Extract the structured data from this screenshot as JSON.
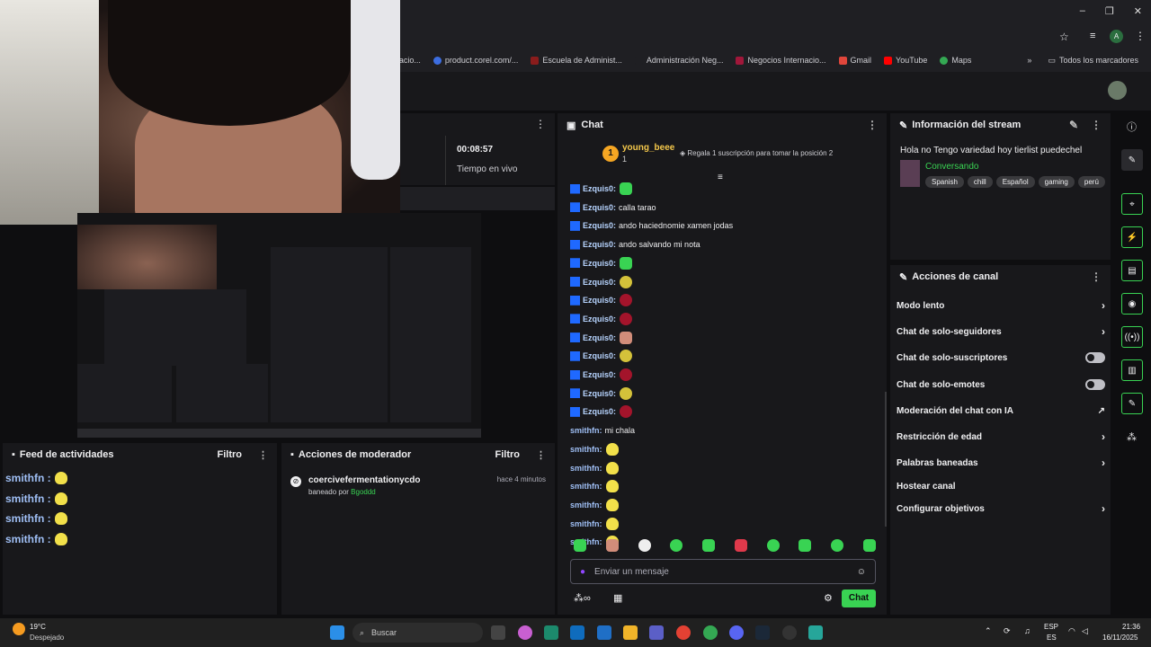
{
  "bookmarks": [
    "Negocios Internacio...",
    "product.corel.com/...",
    "Escuela de Administ...",
    "Administración Neg...",
    "Negocios Internacio...",
    "Gmail",
    "YouTube",
    "Maps"
  ],
  "bookmarks_folder": "Todos los marcadores",
  "stream_stats": {
    "uptime": "00:08:57",
    "uptime_label": "Tiempo en vivo"
  },
  "chat": {
    "title": "Chat",
    "top_gifter": {
      "rank": "1",
      "name": "young_beee",
      "count": "1"
    },
    "gift_prompt": "Regala 1 suscripción para tomar la posición 2",
    "messages": [
      {
        "user": "Ezquis0:",
        "text": "",
        "emote": "e-green"
      },
      {
        "user": "Ezquis0:",
        "text": "calla tarao",
        "emote": ""
      },
      {
        "user": "Ezquis0:",
        "text": "ando haciednomie xamen jodas",
        "emote": ""
      },
      {
        "user": "Ezquis0:",
        "text": "ando salvando mi nota",
        "emote": ""
      },
      {
        "user": "Ezquis0:",
        "text": "",
        "emote": "e-green"
      },
      {
        "user": "Ezquis0:",
        "text": "",
        "emote": "e-yellow"
      },
      {
        "user": "Ezquis0:",
        "text": "",
        "emote": "e-red"
      },
      {
        "user": "Ezquis0:",
        "text": "",
        "emote": "e-red"
      },
      {
        "user": "Ezquis0:",
        "text": "",
        "emote": "e-pink"
      },
      {
        "user": "Ezquis0:",
        "text": "",
        "emote": "e-yellow"
      },
      {
        "user": "Ezquis0:",
        "text": "",
        "emote": "e-red"
      },
      {
        "user": "Ezquis0:",
        "text": "",
        "emote": "e-yellow"
      },
      {
        "user": "Ezquis0:",
        "text": "",
        "emote": "e-red"
      },
      {
        "user": "smithfn:",
        "text": "mi chala",
        "emote": ""
      },
      {
        "user": "smithfn:",
        "text": "",
        "emote": "e-yel2"
      },
      {
        "user": "smithfn:",
        "text": "",
        "emote": "e-yel2"
      },
      {
        "user": "smithfn:",
        "text": "",
        "emote": "e-yel2"
      },
      {
        "user": "smithfn:",
        "text": "",
        "emote": "e-yel2"
      },
      {
        "user": "smithfn:",
        "text": "",
        "emote": "e-yel2"
      },
      {
        "user": "smithfn:",
        "text": "",
        "emote": "e-yel2"
      }
    ],
    "input_placeholder": "Enviar un mensaje",
    "send_label": "Chat"
  },
  "stream_info": {
    "title": "Información del stream",
    "stream_title": "Hola no Tengo variedad hoy tierlist puedechel",
    "category": "Conversando",
    "tags": [
      "Spanish",
      "chill",
      "Español",
      "gaming",
      "perú"
    ]
  },
  "channel_actions": {
    "title": "Acciones de canal",
    "items": [
      {
        "label": "Modo lento",
        "control": "chevron"
      },
      {
        "label": "Chat de solo-seguidores",
        "control": "chevron"
      },
      {
        "label": "Chat de solo-suscriptores",
        "control": "toggle"
      },
      {
        "label": "Chat de solo-emotes",
        "control": "toggle"
      },
      {
        "label": "Moderación del chat con IA",
        "control": "external"
      },
      {
        "label": "Restricción de edad",
        "control": "chevron"
      },
      {
        "label": "Palabras baneadas",
        "control": "chevron"
      },
      {
        "label": "Hostear canal",
        "control": "none"
      },
      {
        "label": "Configurar objetivos",
        "control": "chevron"
      }
    ]
  },
  "activity_feed": {
    "title": "Feed de actividades",
    "filter": "Filtro",
    "items": [
      "smithfn :",
      "smithfn :",
      "smithfn :",
      "smithfn :"
    ]
  },
  "mod_actions": {
    "title": "Acciones de moderador",
    "filter": "Filtro",
    "entry": {
      "user": "coercivefermentationycdo",
      "action": "baneado por",
      "by": "Bgoddd",
      "time": "hace 4 minutos"
    }
  },
  "taskbar": {
    "weather_temp": "19°C",
    "weather_desc": "Despejado",
    "search_placeholder": "Buscar",
    "lang_top": "ESP",
    "lang_bottom": "ES",
    "time": "21:36",
    "date": "16/11/2025"
  },
  "colors": {
    "accent": "#39d353",
    "bg": "#0e0e10",
    "panel": "#18181b",
    "badge": "#1f69ff"
  }
}
